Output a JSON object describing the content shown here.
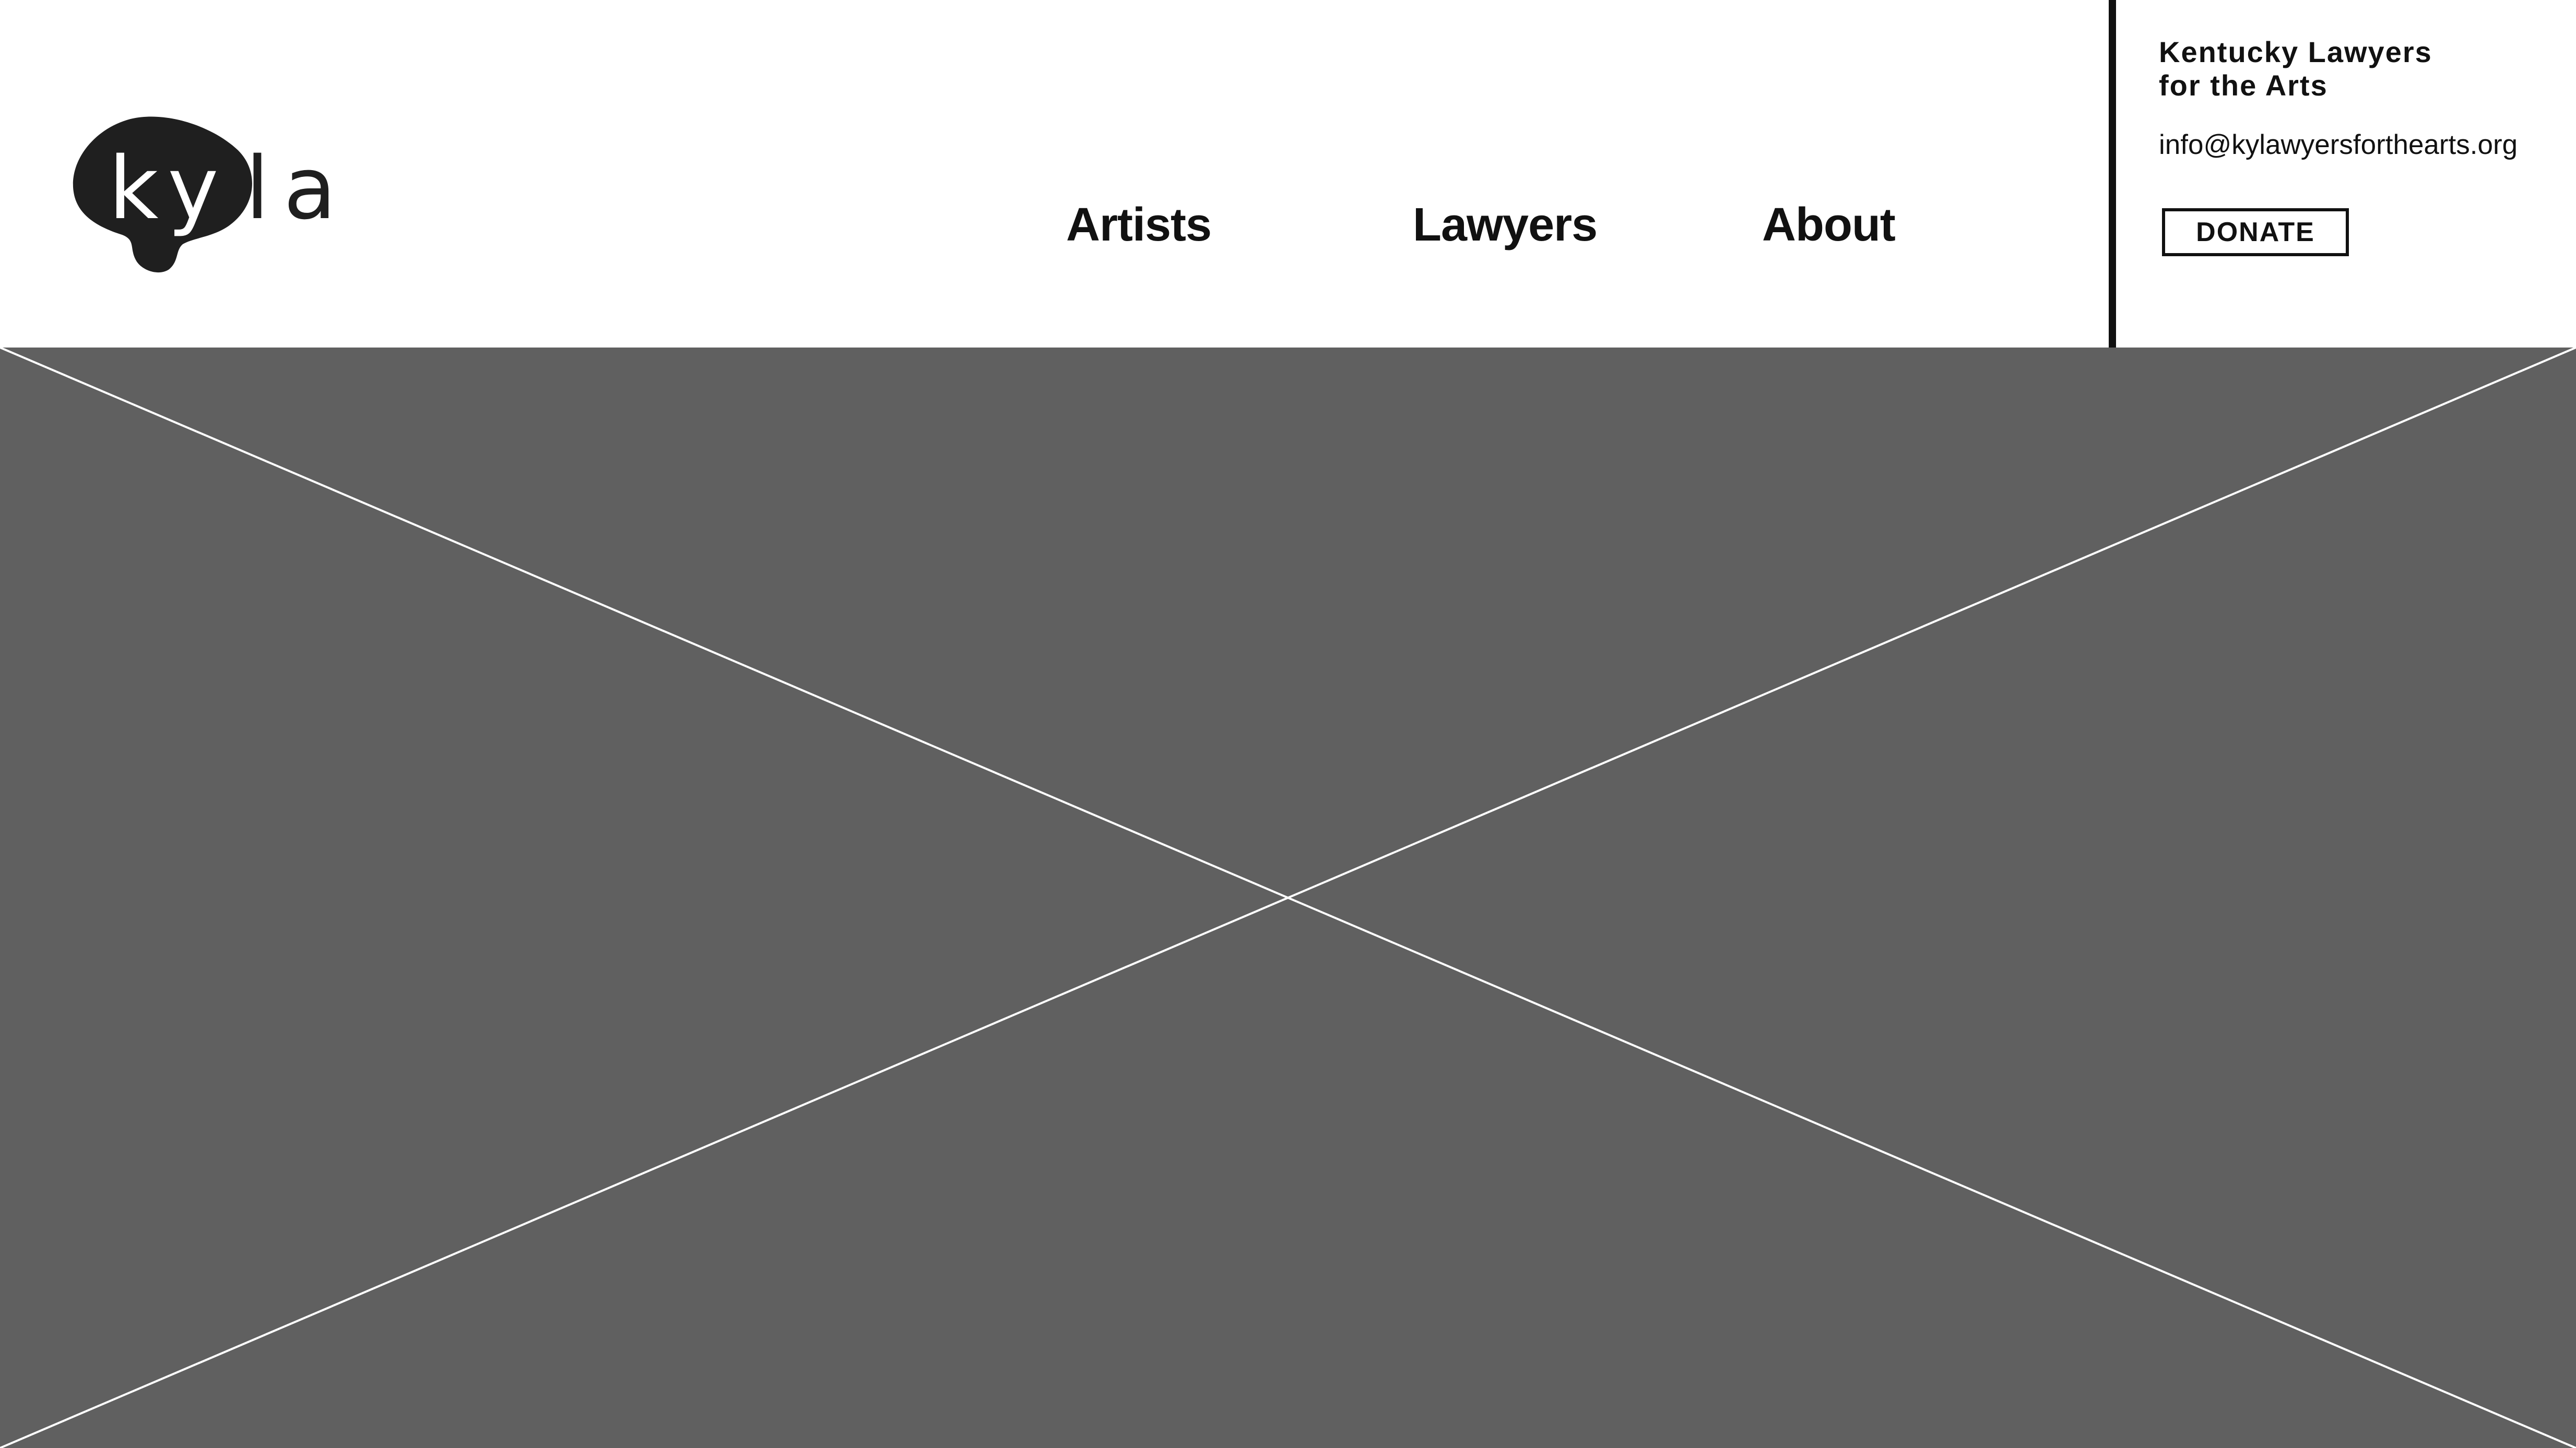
{
  "logo": {
    "text": "kyla",
    "alt": "kyla logo",
    "icon": "ink-blob-logo"
  },
  "nav": {
    "items": [
      {
        "label": "Artists"
      },
      {
        "label": "Lawyers"
      },
      {
        "label": "About"
      }
    ]
  },
  "contact": {
    "org_line1": "Kentucky Lawyers",
    "org_line2": "for the Arts",
    "email": "info@kylawyersforthearts.org",
    "donate_label": "DONATE"
  },
  "hero": {
    "type": "image-placeholder",
    "icon": "cross-placeholder-icon"
  },
  "colors": {
    "text": "#111111",
    "background": "#ffffff",
    "placeholder": "#606060",
    "placeholder_lines": "#ffffff"
  }
}
